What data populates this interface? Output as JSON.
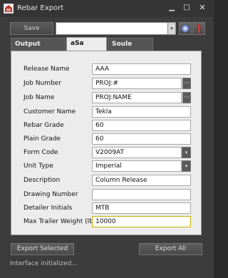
{
  "window": {
    "title": "Rebar Export",
    "min_glyph": "▁",
    "max_glyph": "□",
    "close_glyph": "✕"
  },
  "toolbar": {
    "save_label": "Save",
    "settings_value": "",
    "dropdown_glyph": "▾"
  },
  "tabs": [
    {
      "label": "Output Options",
      "active": false
    },
    {
      "label": "aSa Header",
      "active": true
    },
    {
      "label": "Soule Header",
      "active": false
    }
  ],
  "form": {
    "fields": [
      {
        "label": "Release Name",
        "value": "AAA",
        "control": "text"
      },
      {
        "label": "Job Number",
        "value": "PROJ:#",
        "control": "text-browse"
      },
      {
        "label": "Job Name",
        "value": "PROJ:NAME",
        "control": "text-browse"
      },
      {
        "label": "Customer Name",
        "value": "Tekla",
        "control": "text"
      },
      {
        "label": "Rebar Grade",
        "value": "60",
        "control": "text"
      },
      {
        "label": "Plain Grade",
        "value": "60",
        "control": "text"
      },
      {
        "label": "Form Code",
        "value": "V2009AT",
        "control": "select"
      },
      {
        "label": "Unit Type",
        "value": "Imperial",
        "control": "select"
      },
      {
        "label": "Description",
        "value": "Column Release",
        "control": "text"
      },
      {
        "label": "Drawing Number",
        "value": "",
        "control": "text"
      },
      {
        "label": "Detailer Initials",
        "value": "MTB",
        "control": "text"
      },
      {
        "label": "Max Trailer Weight (lbs)",
        "value": "10000",
        "control": "text"
      }
    ],
    "browse_glyph": "···",
    "select_glyph": "▾"
  },
  "buttons": {
    "export_selected": "Export Selected",
    "export_all": "Export All"
  },
  "status": {
    "text": "Interface initialized..."
  },
  "colors": {
    "window_bg": "#3c3c3c",
    "panel_bg": "#ececec",
    "active_field_border": "#c8b000"
  }
}
